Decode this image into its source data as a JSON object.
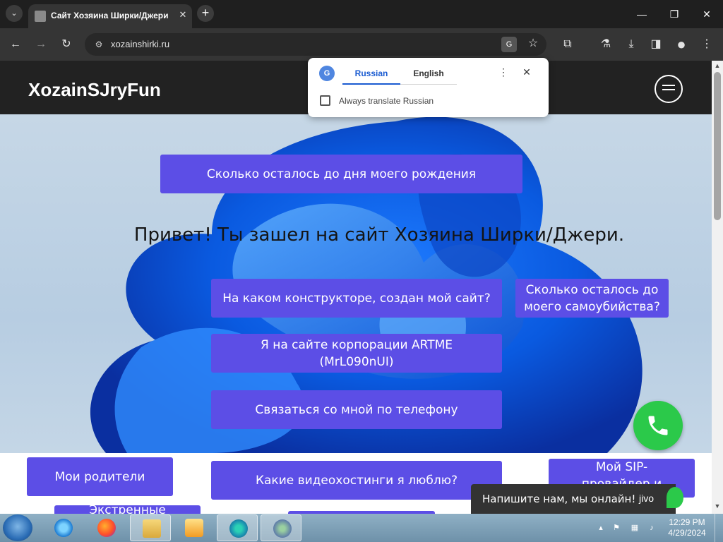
{
  "browser": {
    "tab_title": "Сайт Хозяина Ширки/Джери",
    "tab_close_glyph": "✕",
    "new_tab_glyph": "+",
    "tab_list_glyph": "⌄",
    "url": "xozainshirki.ru",
    "window_controls": {
      "minimize": "—",
      "maximize": "❐",
      "close": "✕"
    },
    "nav_glyphs": {
      "back": "←",
      "forward": "→",
      "reload": "↻",
      "site_info": "⚙",
      "star": "☆",
      "extensions": "⧉",
      "labs": "⚗",
      "downloads": "⤓",
      "sidepanel": "◨",
      "profile": "●",
      "menu": "⋮"
    }
  },
  "translate_popup": {
    "tab_source": "Russian",
    "tab_target": "English",
    "always_translate_label": "Always translate Russian",
    "always_translate_checked": false,
    "more_glyph": "⋮",
    "close_glyph": "✕"
  },
  "site": {
    "logo": "XozainSJryFun",
    "greeting": "Привет! Ты зашел на сайт Хозяина Ширки/Джери.",
    "buttons": {
      "birthday": "Сколько осталось до дня моего рождения",
      "constructor": "На каком конструкторе, создан мой сайт?",
      "suicide": "Сколько осталось до моего самоубийства?",
      "artme": "Я на сайте корпорации ARTME (MrL090nUI)",
      "phone": "Связаться со мной по телефону",
      "parents": "Мои родители",
      "video": "Какие видеохостинги я люблю?",
      "sip": "Мой SIP-провайдер и",
      "emergency": "Экстренные"
    },
    "chat_text": "Напишите нам, мы онлайн!",
    "chat_brand": "jivo",
    "accent": "#5c4ee6",
    "phone_fab_color": "#2bc94a"
  },
  "scrollbar": {
    "up": "▲",
    "down": "▼"
  },
  "taskbar": {
    "time": "12:29 PM",
    "date": "4/29/2024",
    "apps": [
      "internet-explorer",
      "firefox",
      "file-explorer",
      "media-player",
      "chrome",
      "paint"
    ]
  }
}
